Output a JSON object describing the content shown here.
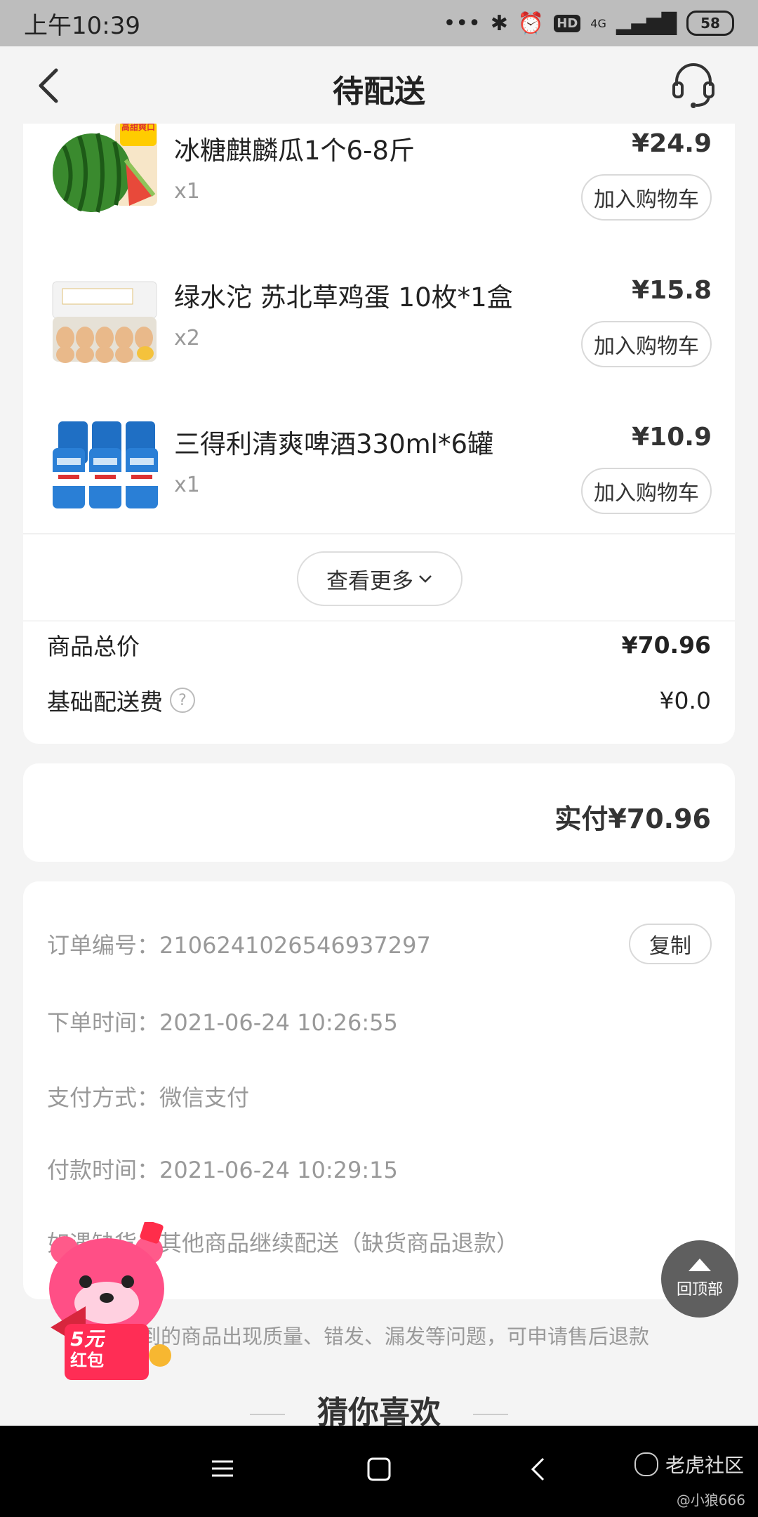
{
  "status_bar": {
    "time": "上午10:39",
    "network": "4G",
    "hd": "HD",
    "battery": "58"
  },
  "header": {
    "title": "待配送"
  },
  "products": [
    {
      "name": "冰糖麒麟瓜1个6-8斤",
      "qty": "x1",
      "price": "¥24.9",
      "add_label": "加入购物车",
      "badge": "高甜爽口"
    },
    {
      "name": "绿水沱 苏北草鸡蛋 10枚*1盒",
      "qty": "x2",
      "price": "¥15.8",
      "add_label": "加入购物车"
    },
    {
      "name": "三得利清爽啤酒330ml*6罐",
      "qty": "x1",
      "price": "¥10.9",
      "add_label": "加入购物车"
    }
  ],
  "more_label": "查看更多",
  "summary": {
    "goods_total_label": "商品总价",
    "goods_total_value": "¥70.96",
    "delivery_label": "基础配送费",
    "delivery_value": "¥0.0"
  },
  "paid": {
    "label": "实付",
    "value": "¥70.96"
  },
  "order_info": {
    "order_no_label": "订单编号：",
    "order_no": "2106241026546937297",
    "copy_label": "复制",
    "order_time_label": "下单时间：",
    "order_time": "2021-06-24 10:26:55",
    "pay_method_label": "支付方式：",
    "pay_method": "微信支付",
    "pay_time_label": "付款时间：",
    "pay_time": "2021-06-24 10:29:15",
    "shortage_label": "如遇缺货：",
    "shortage": "其他商品继续配送（缺货商品退款）"
  },
  "note": "到的商品出现质量、错发、漏发等问题，可申请售后退款",
  "guess_title": "猜你喜欢",
  "back_to_top": "回顶部",
  "promo": {
    "amount": "5元",
    "text": "红包"
  },
  "watermark": {
    "brand": "老虎社区",
    "user": "@小狼666"
  }
}
